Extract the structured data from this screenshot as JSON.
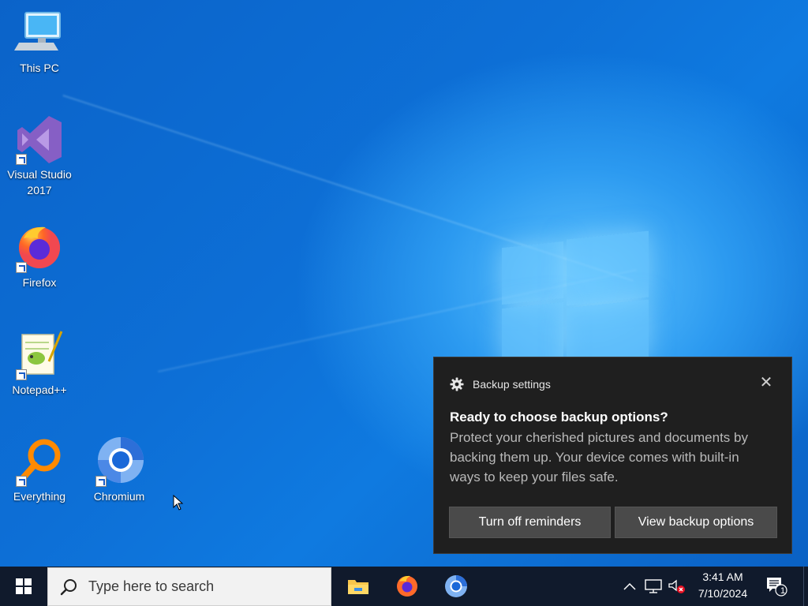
{
  "desktop": {
    "icons": [
      {
        "label": "This PC",
        "icon": "this-pc-icon"
      },
      {
        "label": "Visual Studio 2017",
        "icon": "visual-studio-icon"
      },
      {
        "label": "Firefox",
        "icon": "firefox-icon"
      },
      {
        "label": "Notepad++",
        "icon": "notepad-plus-plus-icon"
      },
      {
        "label": "Everything",
        "icon": "everything-icon"
      },
      {
        "label": "Chromium",
        "icon": "chromium-icon"
      }
    ]
  },
  "toast": {
    "app_name": "Backup settings",
    "title": "Ready to choose backup options?",
    "body": "Protect your cherished pictures and documents by backing them up. Your device comes with built-in ways to keep your files safe.",
    "close_symbol": "✕",
    "buttons": {
      "turn_off": "Turn off reminders",
      "view": "View backup options"
    }
  },
  "taskbar": {
    "search_placeholder": "Type here to search",
    "apps": [
      "file-explorer-icon",
      "firefox-icon",
      "chromium-icon"
    ],
    "tray": {
      "chevron": "^",
      "notification_count": "1"
    },
    "clock": {
      "time": "3:41 AM",
      "date": "7/10/2024"
    }
  },
  "colors": {
    "toast_bg": "#1f1f1f",
    "button_bg": "#4a4a4a",
    "taskbar_bg": "#101a2c",
    "desktop_accent": "#0f7ae0"
  }
}
